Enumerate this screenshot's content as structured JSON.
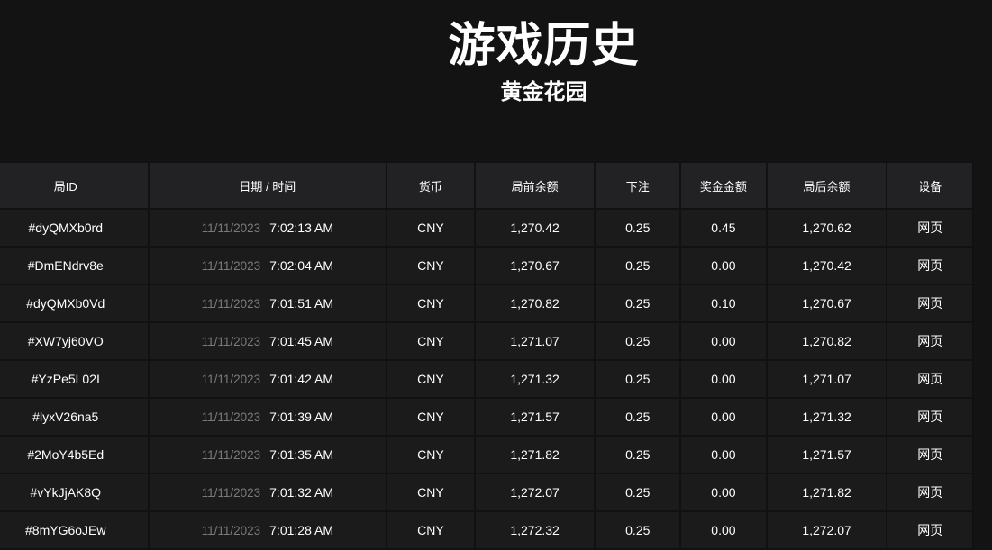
{
  "header": {
    "title": "游戏历史",
    "subtitle": "黄金花园"
  },
  "columns": [
    "局ID",
    "日期 / 时间",
    "货币",
    "局前余额",
    "下注",
    "奖金金额",
    "局后余额",
    "设备"
  ],
  "rows": [
    {
      "id": "#dyQMXb0rd",
      "date": "11/11/2023",
      "time": "7:02:13 AM",
      "currency": "CNY",
      "before": "1,270.42",
      "bet": "0.25",
      "win": "0.45",
      "after": "1,270.62",
      "device": "网页"
    },
    {
      "id": "#DmENdrv8e",
      "date": "11/11/2023",
      "time": "7:02:04 AM",
      "currency": "CNY",
      "before": "1,270.67",
      "bet": "0.25",
      "win": "0.00",
      "after": "1,270.42",
      "device": "网页"
    },
    {
      "id": "#dyQMXb0Vd",
      "date": "11/11/2023",
      "time": "7:01:51 AM",
      "currency": "CNY",
      "before": "1,270.82",
      "bet": "0.25",
      "win": "0.10",
      "after": "1,270.67",
      "device": "网页"
    },
    {
      "id": "#XW7yj60VO",
      "date": "11/11/2023",
      "time": "7:01:45 AM",
      "currency": "CNY",
      "before": "1,271.07",
      "bet": "0.25",
      "win": "0.00",
      "after": "1,270.82",
      "device": "网页"
    },
    {
      "id": "#YzPe5L02I",
      "date": "11/11/2023",
      "time": "7:01:42 AM",
      "currency": "CNY",
      "before": "1,271.32",
      "bet": "0.25",
      "win": "0.00",
      "after": "1,271.07",
      "device": "网页"
    },
    {
      "id": "#lyxV26na5",
      "date": "11/11/2023",
      "time": "7:01:39 AM",
      "currency": "CNY",
      "before": "1,271.57",
      "bet": "0.25",
      "win": "0.00",
      "after": "1,271.32",
      "device": "网页"
    },
    {
      "id": "#2MoY4b5Ed",
      "date": "11/11/2023",
      "time": "7:01:35 AM",
      "currency": "CNY",
      "before": "1,271.82",
      "bet": "0.25",
      "win": "0.00",
      "after": "1,271.57",
      "device": "网页"
    },
    {
      "id": "#vYkJjAK8Q",
      "date": "11/11/2023",
      "time": "7:01:32 AM",
      "currency": "CNY",
      "before": "1,272.07",
      "bet": "0.25",
      "win": "0.00",
      "after": "1,271.82",
      "device": "网页"
    },
    {
      "id": "#8mYG6oJEw",
      "date": "11/11/2023",
      "time": "7:01:28 AM",
      "currency": "CNY",
      "before": "1,272.32",
      "bet": "0.25",
      "win": "0.00",
      "after": "1,272.07",
      "device": "网页"
    }
  ]
}
